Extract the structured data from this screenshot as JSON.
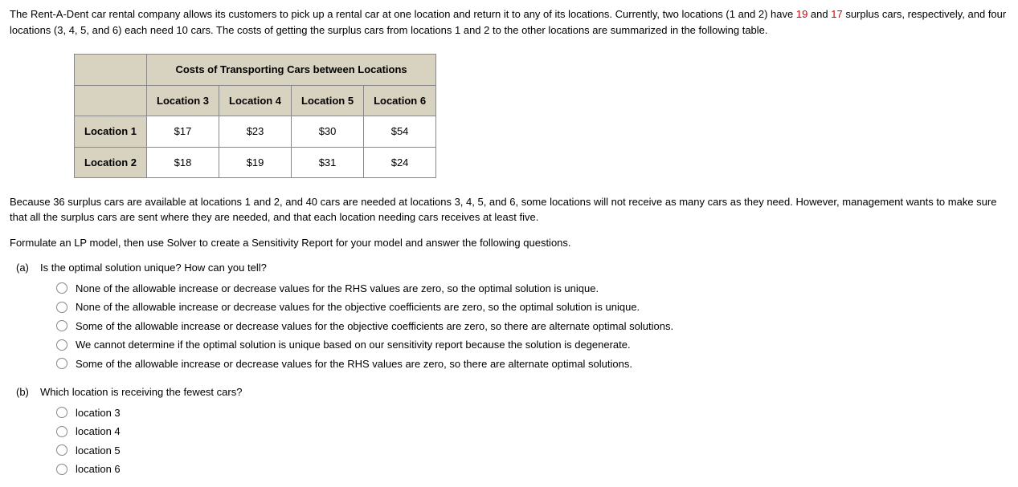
{
  "intro": {
    "t1": "The Rent-A-Dent car rental company allows its customers to pick up a rental car at one location and return it to any of its locations. Currently, two locations (1 and 2) have ",
    "n1": "19",
    "t2": " and ",
    "n2": "17",
    "t3": " surplus cars, respectively, and four locations (3, 4, 5, and 6) each need 10 cars. The costs of getting the surplus cars from locations 1 and 2 to the other locations are summarized in the following table."
  },
  "table": {
    "title": "Costs of Transporting Cars between Locations",
    "cols": [
      "Location 3",
      "Location 4",
      "Location 5",
      "Location 6"
    ],
    "rows": [
      {
        "label": "Location 1",
        "cells": [
          "$17",
          "$23",
          "$30",
          "$54"
        ]
      },
      {
        "label": "Location 2",
        "cells": [
          "$18",
          "$19",
          "$31",
          "$24"
        ]
      }
    ]
  },
  "middle": {
    "p1": "Because 36 surplus cars are available at locations 1 and 2, and 40 cars are needed at locations 3, 4, 5, and 6, some locations will not receive as many cars as they need. However, management wants to make sure that all the surplus cars are sent where they are needed, and that each location needing cars receives at least five.",
    "p2": "Formulate an LP model, then use Solver to create a Sensitivity Report for your model and answer the following questions."
  },
  "parts": {
    "a": {
      "label": "(a)",
      "question": "Is the optimal solution unique? How can you tell?",
      "options": [
        "None of the allowable increase or decrease values for the RHS values are zero, so the optimal solution is unique.",
        "None of the allowable increase or decrease values for the objective coefficients are zero, so the optimal solution is unique.",
        "Some of the allowable increase or decrease values for the objective coefficients are zero, so there are alternate optimal solutions.",
        "We cannot determine if the optimal solution is unique based on our sensitivity report because the solution is degenerate.",
        "Some of the allowable increase or decrease values for the RHS values are zero, so there are alternate optimal solutions."
      ]
    },
    "b": {
      "label": "(b)",
      "question": "Which location is receiving the fewest cars?",
      "options": [
        "location 3",
        "location 4",
        "location 5",
        "location 6"
      ]
    }
  }
}
